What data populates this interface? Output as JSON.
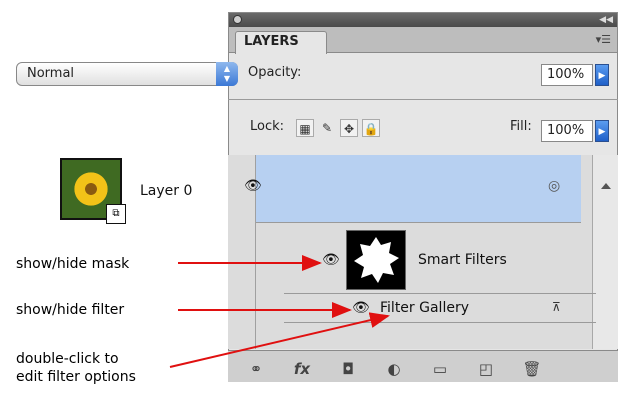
{
  "callouts": {
    "show_hide_mask": "show/hide mask",
    "show_hide_filter": "show/hide filter",
    "double_click_1": "double-click to",
    "double_click_2": "edit filter options"
  },
  "panel": {
    "tab_label": "LAYERS",
    "blend_mode": "Normal",
    "opacity_label": "Opacity:",
    "opacity_value": "100%",
    "lock_label": "Lock:",
    "fill_label": "Fill:",
    "fill_value": "100%"
  },
  "layers": {
    "layer0_name": "Layer 0",
    "smart_filters_name": "Smart Filters",
    "filter_name": "Filter Gallery"
  },
  "icons": {
    "eye": "eye-icon",
    "link": "link-icon",
    "fx": "fx-icon",
    "mask": "add-mask-icon",
    "adjust": "adjustment-layer-icon",
    "folder": "folder-icon",
    "new_layer": "new-layer-icon",
    "trash": "trash-icon"
  },
  "colors": {
    "selected_row": "#b7d0f1",
    "arrow": "#e01010"
  }
}
